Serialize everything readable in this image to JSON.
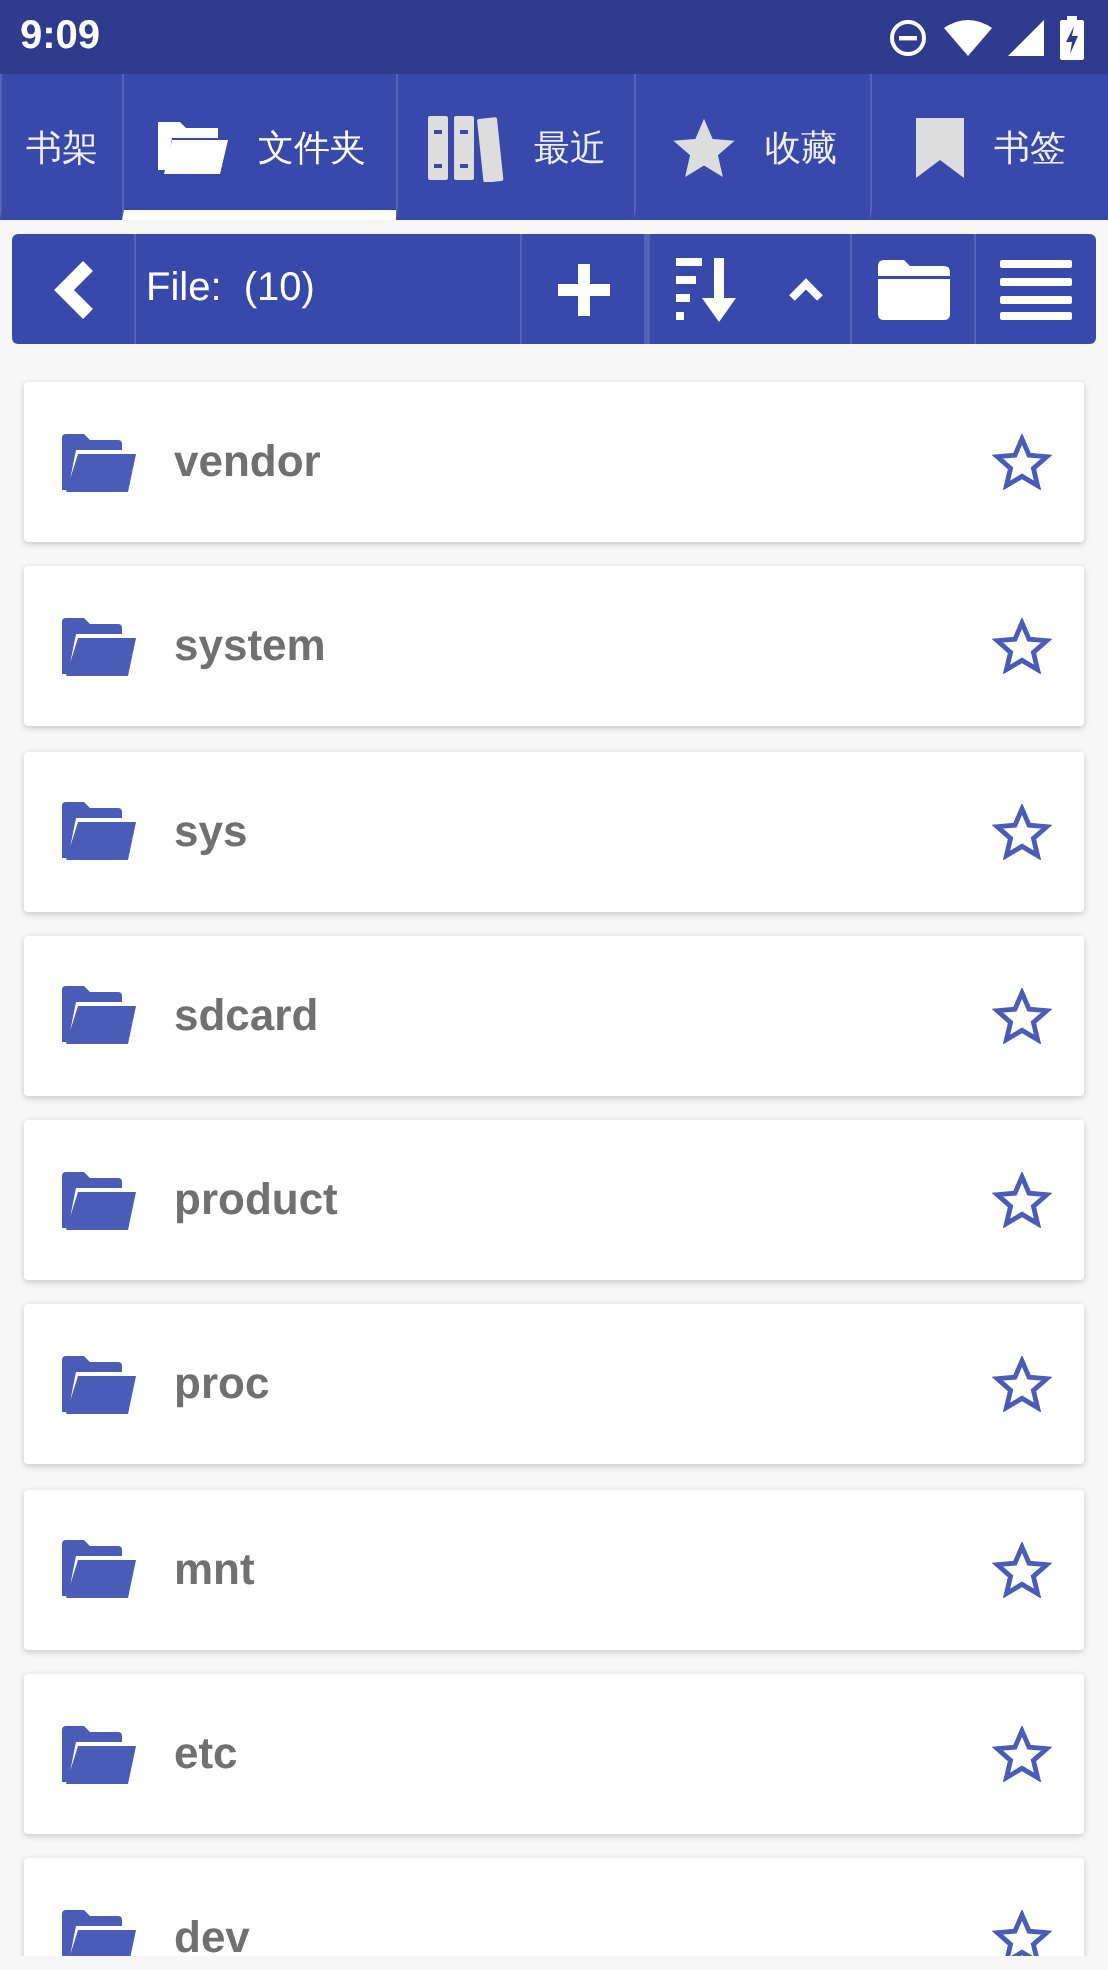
{
  "status_bar": {
    "time": "9:09"
  },
  "tabs": [
    {
      "label": "书架",
      "kind": "text",
      "selected": false
    },
    {
      "label": "文件夹",
      "kind": "folder",
      "selected": true
    },
    {
      "label": "最近",
      "kind": "books",
      "selected": false
    },
    {
      "label": "收藏",
      "kind": "star",
      "selected": false
    },
    {
      "label": "书签",
      "kind": "bookmark",
      "selected": false
    }
  ],
  "toolbar": {
    "title": "File:  (10)"
  },
  "files": [
    {
      "name": "vendor",
      "starred": false
    },
    {
      "name": "system",
      "starred": false
    },
    {
      "name": "sys",
      "starred": false
    },
    {
      "name": "sdcard",
      "starred": false
    },
    {
      "name": "product",
      "starred": false
    },
    {
      "name": "proc",
      "starred": false
    },
    {
      "name": "mnt",
      "starred": false
    },
    {
      "name": "etc",
      "starred": false
    },
    {
      "name": "dev",
      "starred": false
    }
  ]
}
